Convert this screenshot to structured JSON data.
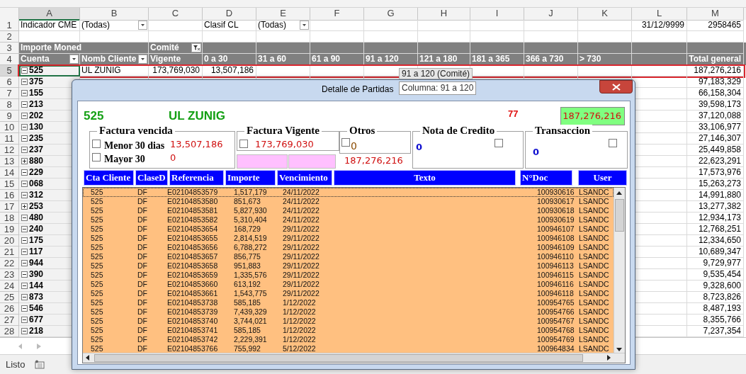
{
  "sheet": {
    "columns": [
      "A",
      "B",
      "C",
      "D",
      "E",
      "F",
      "G",
      "H",
      "I",
      "J",
      "K",
      "L",
      "M"
    ],
    "rows": [
      {
        "number": "1",
        "kind": "plain",
        "cells": [
          {
            "text": "Indicador CME"
          },
          {
            "text": "(Todas)",
            "dropdown": true
          },
          null,
          {
            "text": "Clasif CL"
          },
          {
            "text": "(Todas)",
            "dropdown": true
          },
          null,
          null,
          null,
          null,
          null,
          null,
          {
            "text": "31/12/9999",
            "kind": "number"
          },
          {
            "text": "2958465",
            "kind": "number"
          }
        ]
      },
      {
        "number": "2",
        "kind": "plain"
      },
      {
        "number": "3",
        "kind": "header",
        "cells": [
          {
            "text": "Importe Moned"
          },
          null,
          {
            "text": "Comité",
            "filtered": true
          }
        ]
      },
      {
        "number": "4",
        "kind": "header",
        "cells": [
          {
            "text": "Cuenta",
            "dropdown": true
          },
          {
            "text": "Nomb Cliente",
            "dropdown": true
          },
          {
            "text": "Vigente"
          },
          {
            "text": "0 a 30"
          },
          {
            "text": "31 a 60"
          },
          {
            "text": "61 a 90"
          },
          {
            "text": "91 a 120"
          },
          {
            "text": "121 a 180"
          },
          {
            "text": "181 a 365"
          },
          {
            "text": "366 a 730"
          },
          {
            "text": "> 730"
          },
          null,
          {
            "text": "Total general",
            "kind": "number"
          }
        ]
      },
      {
        "number": "5",
        "kind": "item",
        "expanded": true,
        "selected": true,
        "account": "525",
        "total": "187,276,216",
        "cells": [
          {
            "text": "UL ZUNIG"
          },
          {
            "text": "173,769,030",
            "kind": "number"
          },
          {
            "text": "13,507,186",
            "kind": "number"
          }
        ]
      },
      {
        "number": "6",
        "kind": "item",
        "expanded": true,
        "selected": false,
        "account": "375",
        "total": "97,183,329"
      },
      {
        "number": "7",
        "kind": "item",
        "expanded": true,
        "selected": false,
        "account": "155",
        "total": "66,158,304"
      },
      {
        "number": "8",
        "kind": "item",
        "expanded": true,
        "selected": false,
        "account": "213",
        "total": "39,598,173"
      },
      {
        "number": "9",
        "kind": "item",
        "expanded": true,
        "selected": false,
        "account": "202",
        "total": "37,120,088"
      },
      {
        "number": "10",
        "kind": "item",
        "expanded": true,
        "selected": false,
        "account": "130",
        "total": "33,106,977"
      },
      {
        "number": "11",
        "kind": "item",
        "expanded": true,
        "selected": false,
        "account": "235",
        "total": "27,146,307"
      },
      {
        "number": "12",
        "kind": "item",
        "expanded": true,
        "selected": false,
        "account": "237",
        "total": "25,449,858"
      },
      {
        "number": "13",
        "kind": "item",
        "expanded": false,
        "selected": false,
        "account": "880",
        "total": "22,623,291"
      },
      {
        "number": "14",
        "kind": "item",
        "expanded": true,
        "selected": false,
        "account": "229",
        "total": "17,573,976"
      },
      {
        "number": "15",
        "kind": "item",
        "expanded": true,
        "selected": false,
        "account": "068",
        "total": "15,263,273"
      },
      {
        "number": "16",
        "kind": "item",
        "expanded": true,
        "selected": false,
        "account": "312",
        "total": "14,991,880"
      },
      {
        "number": "17",
        "kind": "item",
        "expanded": false,
        "selected": false,
        "account": "253",
        "total": "13,277,382"
      },
      {
        "number": "18",
        "kind": "item",
        "expanded": true,
        "selected": false,
        "account": "480",
        "total": "12,934,173"
      },
      {
        "number": "19",
        "kind": "item",
        "expanded": true,
        "selected": false,
        "account": "240",
        "total": "12,768,251"
      },
      {
        "number": "20",
        "kind": "item",
        "expanded": true,
        "selected": false,
        "account": "175",
        "total": "12,334,650"
      },
      {
        "number": "21",
        "kind": "item",
        "expanded": true,
        "selected": false,
        "account": "117",
        "total": "10,689,347"
      },
      {
        "number": "22",
        "kind": "item",
        "expanded": true,
        "selected": false,
        "account": "944",
        "total": "9,729,977"
      },
      {
        "number": "23",
        "kind": "item",
        "expanded": true,
        "selected": false,
        "account": "390",
        "total": "9,535,454"
      },
      {
        "number": "24",
        "kind": "item",
        "expanded": true,
        "selected": false,
        "account": "144",
        "total": "9,328,600"
      },
      {
        "number": "25",
        "kind": "item",
        "expanded": true,
        "selected": false,
        "account": "873",
        "total": "8,723,826"
      },
      {
        "number": "26",
        "kind": "item",
        "expanded": true,
        "selected": false,
        "account": "546",
        "total": "8,487,193"
      },
      {
        "number": "27",
        "kind": "item",
        "expanded": true,
        "selected": false,
        "account": "677",
        "total": "8,355,766"
      },
      {
        "number": "28",
        "kind": "item",
        "expanded": true,
        "selected": false,
        "account": "218",
        "total": "7,237,354"
      }
    ]
  },
  "tooltips": [
    "91 a 120 (Comité)",
    "Columna: 91 a 120"
  ],
  "dialog": {
    "title": "Detalle de Partidas",
    "account": "525",
    "client": "UL ZUNIG",
    "count": "77",
    "total": "187,276,216",
    "subtotal": "187,276,216",
    "groups": [
      {
        "kind": "overdue",
        "title": "Factura vencida",
        "items": [
          {
            "label": "Menor 30 dias",
            "checked": false,
            "value": "13,507,186"
          },
          {
            "label": "Mayor 30",
            "checked": false,
            "value": "0"
          }
        ]
      },
      {
        "kind": "current",
        "title": "Factura Vigente",
        "items": [
          {
            "checked": false,
            "value": "173,769,030"
          }
        ]
      },
      {
        "kind": "other",
        "title": "Otros",
        "items": [
          {
            "checked": false,
            "value": "0"
          }
        ]
      },
      {
        "kind": "credit",
        "title": "Nota de Credito",
        "items": [
          {
            "checked": false,
            "value": "0"
          }
        ]
      },
      {
        "kind": "transaction",
        "title": "Transaccion",
        "items": [
          {
            "checked": false,
            "value": "0"
          }
        ]
      }
    ],
    "columns": [
      "Cta Cliente",
      "ClaseD",
      "Referencia",
      "Importe",
      "Vencimiento",
      "Texto",
      "N°Doc",
      "User"
    ],
    "rows": [
      {
        "selected": true,
        "cta": "525",
        "clase": "DF",
        "ref": "E02104853579",
        "importe": "1,517,179",
        "venc": "24/11/2022",
        "doc": "100930616",
        "user": "LSANDC"
      },
      {
        "selected": false,
        "cta": "525",
        "clase": "DF",
        "ref": "E02104853580",
        "importe": "851,673",
        "venc": "24/11/2022",
        "doc": "100930617",
        "user": "LSANDC"
      },
      {
        "selected": false,
        "cta": "525",
        "clase": "DF",
        "ref": "E02104853581",
        "importe": "5,827,930",
        "venc": "24/11/2022",
        "doc": "100930618",
        "user": "LSANDC"
      },
      {
        "selected": false,
        "cta": "525",
        "clase": "DF",
        "ref": "E02104853582",
        "importe": "5,310,404",
        "venc": "24/11/2022",
        "doc": "100930619",
        "user": "LSANDC"
      },
      {
        "selected": false,
        "cta": "525",
        "clase": "DF",
        "ref": "E02104853654",
        "importe": "168,729",
        "venc": "29/11/2022",
        "doc": "100946107",
        "user": "LSANDC"
      },
      {
        "selected": false,
        "cta": "525",
        "clase": "DF",
        "ref": "E02104853655",
        "importe": "2,814,519",
        "venc": "29/11/2022",
        "doc": "100946108",
        "user": "LSANDC"
      },
      {
        "selected": false,
        "cta": "525",
        "clase": "DF",
        "ref": "E02104853656",
        "importe": "6,788,272",
        "venc": "29/11/2022",
        "doc": "100946109",
        "user": "LSANDC"
      },
      {
        "selected": false,
        "cta": "525",
        "clase": "DF",
        "ref": "E02104853657",
        "importe": "856,775",
        "venc": "29/11/2022",
        "doc": "100946110",
        "user": "LSANDC"
      },
      {
        "selected": false,
        "cta": "525",
        "clase": "DF",
        "ref": "E02104853658",
        "importe": "951,883",
        "venc": "29/11/2022",
        "doc": "100946113",
        "user": "LSANDC"
      },
      {
        "selected": false,
        "cta": "525",
        "clase": "DF",
        "ref": "E02104853659",
        "importe": "1,335,576",
        "venc": "29/11/2022",
        "doc": "100946115",
        "user": "LSANDC"
      },
      {
        "selected": false,
        "cta": "525",
        "clase": "DF",
        "ref": "E02104853660",
        "importe": "613,192",
        "venc": "29/11/2022",
        "doc": "100946116",
        "user": "LSANDC"
      },
      {
        "selected": false,
        "cta": "525",
        "clase": "DF",
        "ref": "E02104853661",
        "importe": "1,543,775",
        "venc": "29/11/2022",
        "doc": "100946118",
        "user": "LSANDC"
      },
      {
        "selected": false,
        "cta": "525",
        "clase": "DF",
        "ref": "E02104853738",
        "importe": "585,185",
        "venc": "1/12/2022",
        "doc": "100954765",
        "user": "LSANDC"
      },
      {
        "selected": false,
        "cta": "525",
        "clase": "DF",
        "ref": "E02104853739",
        "importe": "7,439,329",
        "venc": "1/12/2022",
        "doc": "100954766",
        "user": "LSANDC"
      },
      {
        "selected": false,
        "cta": "525",
        "clase": "DF",
        "ref": "E02104853740",
        "importe": "3,744,021",
        "venc": "1/12/2022",
        "doc": "100954767",
        "user": "LSANDC"
      },
      {
        "selected": false,
        "cta": "525",
        "clase": "DF",
        "ref": "E02104853741",
        "importe": "585,185",
        "venc": "1/12/2022",
        "doc": "100954768",
        "user": "LSANDC"
      },
      {
        "selected": false,
        "cta": "525",
        "clase": "DF",
        "ref": "E02104853742",
        "importe": "2,229,391",
        "venc": "1/12/2022",
        "doc": "100954769",
        "user": "LSANDC"
      },
      {
        "selected": false,
        "cta": "525",
        "clase": "DF",
        "ref": "E02104853766",
        "importe": "755,992",
        "venc": "5/12/2022",
        "doc": "100964834",
        "user": "LSANDC"
      }
    ]
  },
  "status_bar": {
    "text": "Listo"
  }
}
